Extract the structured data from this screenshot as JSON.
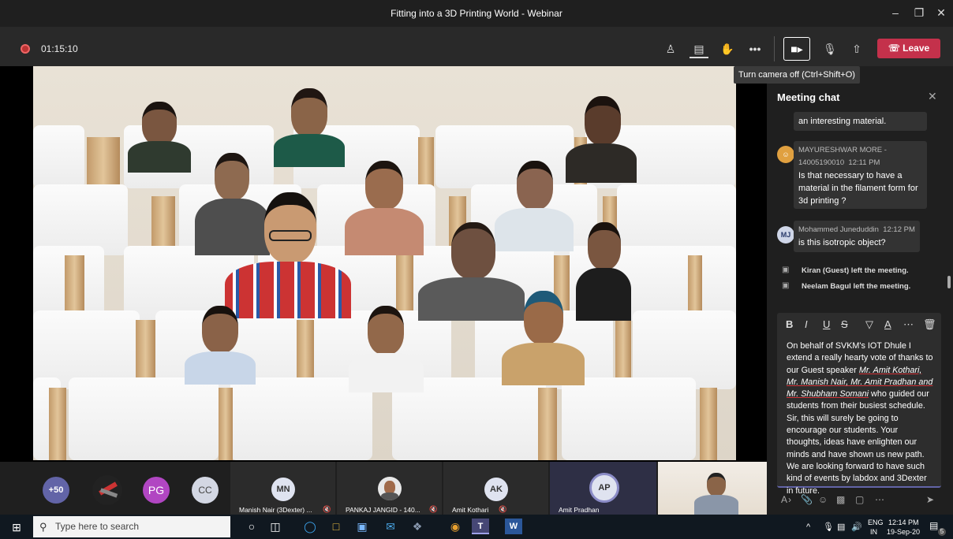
{
  "window": {
    "title": "Fitting into a 3D Printing World - Webinar"
  },
  "toolbar": {
    "timer": "01:15:10",
    "leave_label": "Leave",
    "tooltip": "Turn camera off (Ctrl+Shift+O)"
  },
  "chat": {
    "title": "Meeting chat",
    "partial_message": "an interesting material.",
    "messages": [
      {
        "author": "MAYURESHWAR MORE - 14005190010",
        "time": "12:11 PM",
        "text": "Is that necessary to have a material in the filament form for 3d printing ?"
      },
      {
        "initials": "MJ",
        "author": "Mohammed Juneduddin",
        "time": "12:12 PM",
        "text": "is this isotropic object?"
      }
    ],
    "events": [
      "Kiran (Guest) left the meeting.",
      "Neelam Bagul left the meeting."
    ],
    "compose": {
      "intro": "On behalf of SVKM's IOT Dhule I extend a really hearty vote of thanks to our Guest speaker ",
      "names": "Mr. Amit Kothari, Mr. Manish Nair, Mr. Amit Pradhan and Mr. Shubham Somani",
      "rest": " who guided our students from their busiest schedule. Sir, this will surely be going to encourage our students. Your thoughts, ideas have enlighten our minds and have shown us new path. We are looking forward to have such kind of events by labdox and 3Dexter in future."
    }
  },
  "gallery": {
    "overflow": "+50",
    "avatars": [
      "PG",
      "CC"
    ],
    "tiles": [
      {
        "initials": "MN",
        "name": "Manish Nair (3Dexter) ..."
      },
      {
        "initials": "",
        "name": "PANKAJ JANGID - 140..."
      },
      {
        "initials": "AK",
        "name": "Amit Kothari"
      },
      {
        "initials": "AP",
        "name": "Amit Pradhan"
      }
    ]
  },
  "taskbar": {
    "search_placeholder": "Type here to search",
    "lang": "ENG",
    "region": "IN",
    "time": "12:14 PM",
    "date": "19-Sep-20",
    "notifications": "5"
  },
  "colors": {
    "leave": "#c4314b",
    "accent": "#6264a7",
    "presenter_ring": "#8b8cc7"
  }
}
